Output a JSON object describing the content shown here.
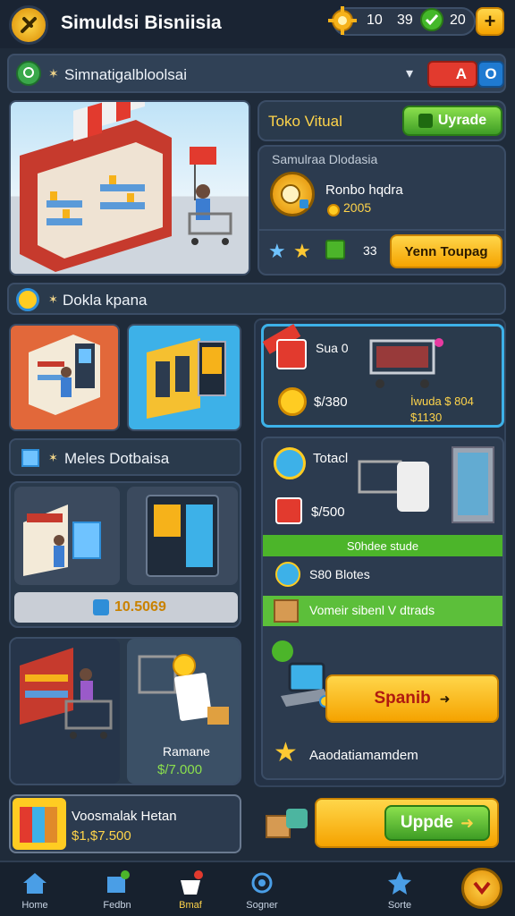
{
  "header": {
    "title": "Simuldsi Bisniisia",
    "stat_1": "10",
    "stat_2": "39",
    "stat_3": "20",
    "add_label": "+"
  },
  "subheader": {
    "title": "Simnatigalbloolsai",
    "flag_a": "A",
    "flag_o": "O"
  },
  "toko_card": {
    "title": "Toko Vitual",
    "upgrade_label": "Uyrade",
    "subtitle": "Samulraa Dlodasia",
    "business_name": "Ronbo hqdra",
    "coins": "2005",
    "count": "33",
    "action_label": "Yenn Toupag"
  },
  "section_1": {
    "title": "Dokla kpana"
  },
  "featured": {
    "price_1": "$/380",
    "price_2": "İwuda $ 804",
    "price_3": "$1130",
    "label": "Sua 0"
  },
  "section_2": {
    "title": "Meles Dotbaisa"
  },
  "price_bar": {
    "value": "10.5069"
  },
  "right_card": {
    "title": "Totacl",
    "price": "$/500",
    "green_label": "S0hdee stude",
    "row_1": "S80 Blotes",
    "row_2": "Vomeir sibenl V dtrads",
    "spin_label": "Spanib",
    "bottom_label": "Aaodatiamamdem"
  },
  "tile_bottom": {
    "title": "Ramane",
    "price": "$/7.000"
  },
  "bottom_panel": {
    "title": "Voosmalak Hetan",
    "price": "$1,$7.500",
    "upgrade_label": "Uppde"
  },
  "nav": {
    "items": [
      {
        "label": "Home"
      },
      {
        "label": "Fedbn"
      },
      {
        "label": "Bmaf"
      },
      {
        "label": "Sogner"
      },
      {
        "label": "Sorte"
      }
    ]
  },
  "colors": {
    "accent_yellow": "#f5a300",
    "accent_green": "#3e9d25",
    "bg": "#1f2b3a"
  }
}
